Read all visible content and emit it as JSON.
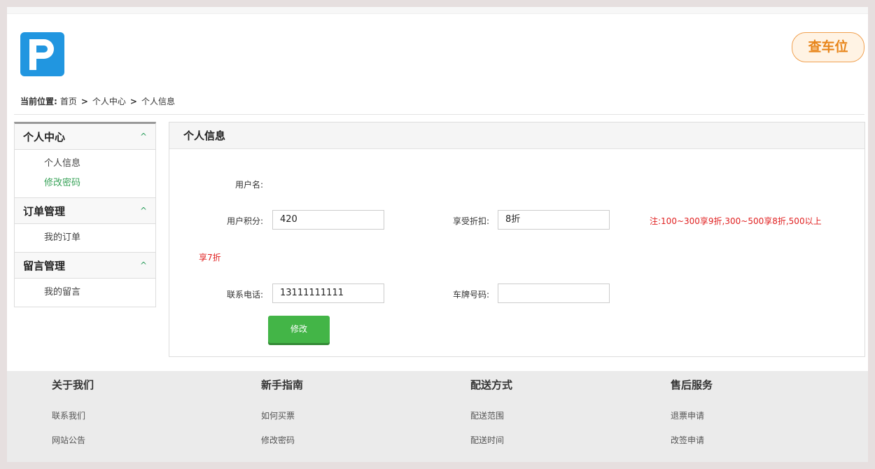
{
  "header": {
    "check_button": "查车位"
  },
  "breadcrumb": {
    "label": "当前位置:",
    "items": [
      "首页",
      "个人中心",
      "个人信息"
    ],
    "separator": ">"
  },
  "sidebar": {
    "groups": [
      {
        "title": "个人中心",
        "items": [
          {
            "label": "个人信息"
          },
          {
            "label": "修改密码"
          }
        ]
      },
      {
        "title": "订单管理",
        "items": [
          {
            "label": "我的订单"
          }
        ]
      },
      {
        "title": "留言管理",
        "items": [
          {
            "label": "我的留言"
          }
        ]
      }
    ],
    "active_color": "#3aa35a"
  },
  "panel": {
    "title": "个人信息",
    "username_label": "用户名:",
    "points_label": "用户积分:",
    "points_value": "420",
    "discount_label": "享受折扣:",
    "discount_value": "8折",
    "note_line1": "注:100~300享9折,300~500享8折,500以上",
    "note_line2": "享7折",
    "phone_label": "联系电话:",
    "phone_value": "13111111111",
    "plate_label": "车牌号码:",
    "plate_value": "",
    "edit_button": "修改"
  },
  "footer": {
    "columns": [
      {
        "title": "关于我们",
        "links": [
          "联系我们",
          "网站公告"
        ]
      },
      {
        "title": "新手指南",
        "links": [
          "如何买票",
          "修改密码"
        ]
      },
      {
        "title": "配送方式",
        "links": [
          "配送范围",
          "配送时间"
        ]
      },
      {
        "title": "售后服务",
        "links": [
          "退票申请",
          "改签申请"
        ]
      }
    ]
  },
  "colors": {
    "brand": "#2196e0",
    "accent_orange": "#e8861c",
    "note_red": "#e02020",
    "button_green": "#43b547"
  }
}
